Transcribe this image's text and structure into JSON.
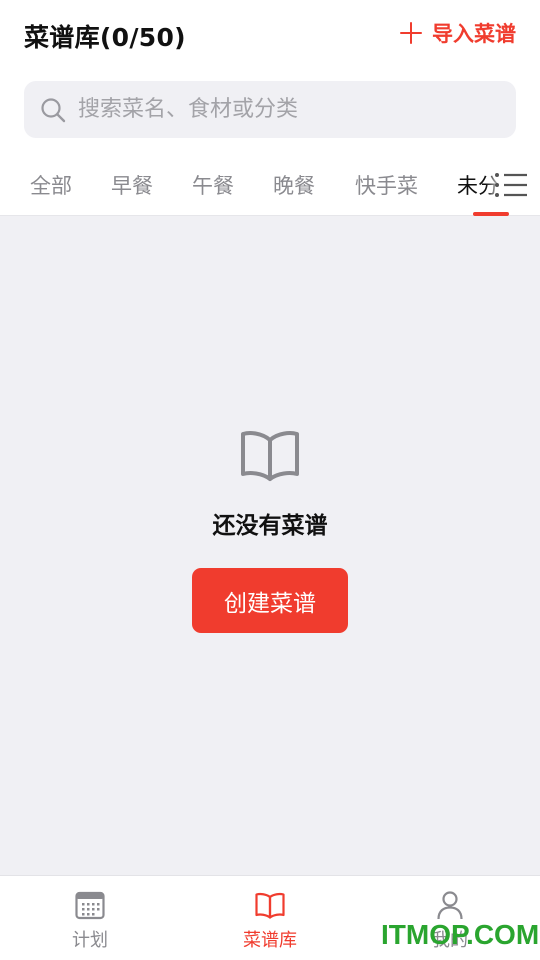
{
  "header": {
    "title": "菜谱库(0/50)",
    "import_label": "导入菜谱"
  },
  "search": {
    "placeholder": "搜索菜名、食材或分类"
  },
  "tabs": [
    {
      "label": "全部",
      "active": false
    },
    {
      "label": "早餐",
      "active": false
    },
    {
      "label": "午餐",
      "active": false
    },
    {
      "label": "晚餐",
      "active": false
    },
    {
      "label": "快手菜",
      "active": false
    },
    {
      "label": "未分",
      "active": true
    }
  ],
  "empty_state": {
    "message": "还没有菜谱",
    "create_label": "创建菜谱"
  },
  "bottom_nav": [
    {
      "label": "计划",
      "icon": "calendar-icon",
      "active": false
    },
    {
      "label": "菜谱库",
      "icon": "book-icon",
      "active": true
    },
    {
      "label": "我的",
      "icon": "user-icon",
      "active": false
    }
  ],
  "watermark": "ITMOP.COM",
  "colors": {
    "accent": "#f03c2e",
    "background": "#f0f0f4",
    "muted_text": "#8a8a8f",
    "watermark": "#2aa52f"
  }
}
